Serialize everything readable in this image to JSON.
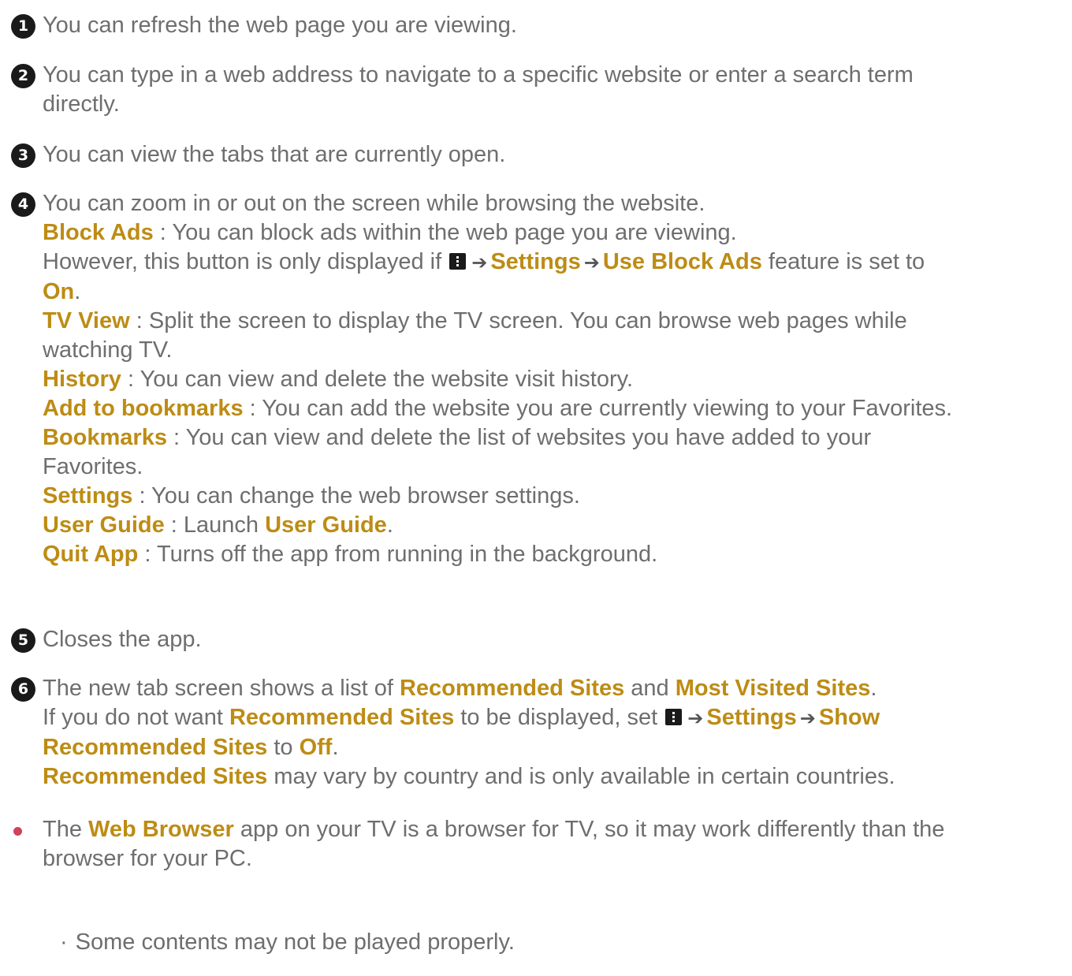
{
  "items": [
    {
      "num": "1",
      "text": "You can refresh the web page you are viewing."
    },
    {
      "num": "2",
      "text": "You can type in a web address to navigate to a specific website or enter a search term",
      "text2": "directly."
    },
    {
      "num": "3",
      "text": "You can view the tabs that are currently open."
    },
    {
      "num": "4",
      "text": "You can zoom in or out on the screen while browsing the website."
    },
    {
      "num": "5",
      "text": "Closes the app."
    },
    {
      "num": "6",
      "text_a": "The new tab screen shows a list of ",
      "hl_a": "Recommended Sites",
      "text_b": " and ",
      "hl_b": "Most Visited Sites",
      "text_c": "."
    }
  ],
  "zoom_menu": {
    "block_ads": {
      "label": "Block Ads",
      "desc": " : You can block ads within the web page you are viewing."
    },
    "however": {
      "text_a": "However, this button is only displayed if ",
      "settings": "Settings",
      "use_block_ads": "Use Block Ads",
      "text_b": " feature is set to",
      "on": "On",
      "period": "."
    },
    "tv_view": {
      "label": "TV View",
      "desc": " : Split the screen to display the TV screen. You can browse web pages while",
      "desc2": "watching TV."
    },
    "history": {
      "label": "History",
      "desc": " : You can view and delete the website visit history."
    },
    "add_bookmarks": {
      "label": "Add to bookmarks",
      "desc": " : You can add the website you are currently viewing to your Favorites."
    },
    "bookmarks": {
      "label": "Bookmarks",
      "desc": " : You can view and delete the list of websites you have added to your",
      "desc2": "Favorites."
    },
    "settings": {
      "label": "Settings",
      "desc": " : You can change the web browser settings."
    },
    "user_guide": {
      "label": "User Guide",
      "desc": " : Launch ",
      "target": "User Guide",
      "period": "."
    },
    "quit_app": {
      "label": "Quit App",
      "desc": " : Turns off the app from running in the background."
    }
  },
  "rec_sites": {
    "line1_a": "If you do not want ",
    "rec": "Recommended Sites",
    "line1_b": " to be displayed, set ",
    "settings": "Settings",
    "show": "Show",
    "rec2": "Recommended Sites",
    "to": " to ",
    "off": "Off",
    "period": ".",
    "line3_label": "Recommended Sites",
    "line3_text": " may vary by country and is only available in certain countries."
  },
  "arrow_glyph": "➔",
  "bullet": {
    "text_a": "The ",
    "hl": "Web Browser",
    "text_b": " app on your TV is a browser for TV, so it may work differently than the",
    "text2": "browser for your PC."
  },
  "sub_bullet": {
    "mark": "·",
    "text": "Some contents may not be played properly."
  },
  "colors": {
    "highlight": "#bd8c14",
    "text": "#6e6e6e",
    "bullet": "#d2405a",
    "circle": "#1a1a1a"
  }
}
